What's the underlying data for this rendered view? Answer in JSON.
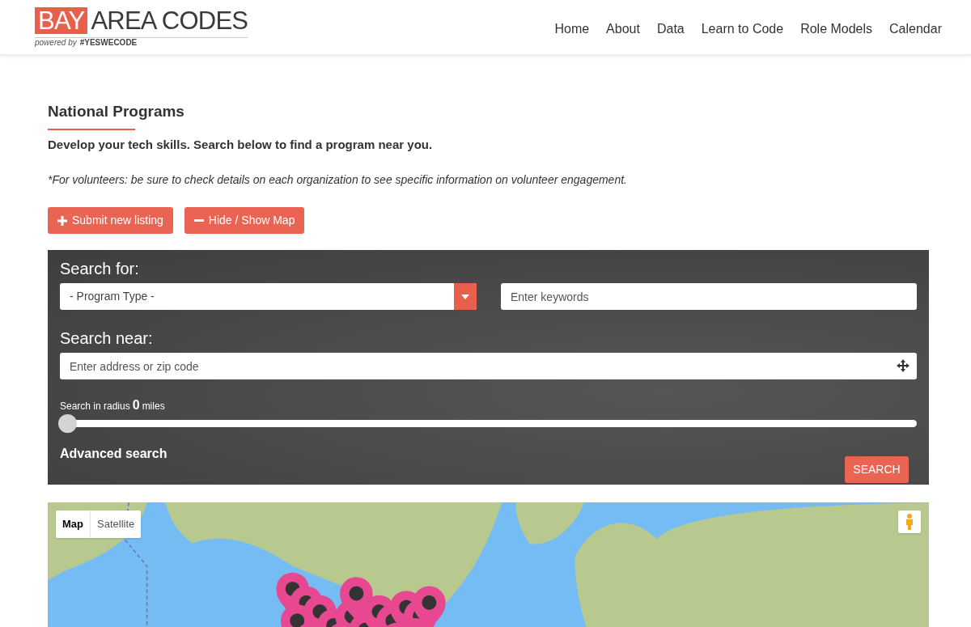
{
  "logo": {
    "highlight": "BAY",
    "rest": "AREA CODES",
    "tagline_prefix": "powered by",
    "tagline_tag": "#YESWECODE"
  },
  "nav": [
    {
      "label": "Home"
    },
    {
      "label": "About"
    },
    {
      "label": "Data"
    },
    {
      "label": "Learn to Code"
    },
    {
      "label": "Role Models"
    },
    {
      "label": "Calendar"
    }
  ],
  "page": {
    "title": "National Programs",
    "subtitle": "Develop your tech skills. Search below to find a program near you.",
    "note": "*For volunteers: be sure to check details on each organization to see specific information on volunteer engagement."
  },
  "actions": [
    {
      "label": "Submit new listing",
      "kind": "plus"
    },
    {
      "label": "Hide / Show Map",
      "kind": "minus"
    }
  ],
  "search": {
    "for_label": "Search for:",
    "program_type": "- Program Type -",
    "keywords_placeholder": "Enter keywords",
    "near_label": "Search near:",
    "address_placeholder": "Enter address or zip code",
    "radius_prefix": "Search in radius",
    "radius_value": "0",
    "radius_suffix": "miles",
    "radius": {
      "level": 0
    },
    "advanced": "Advanced search",
    "button": "SEARCH"
  },
  "map": {
    "kind": "picture",
    "types": [
      {
        "label": "Map",
        "selected": true
      },
      {
        "label": "Satellite",
        "selected": false
      }
    ]
  }
}
